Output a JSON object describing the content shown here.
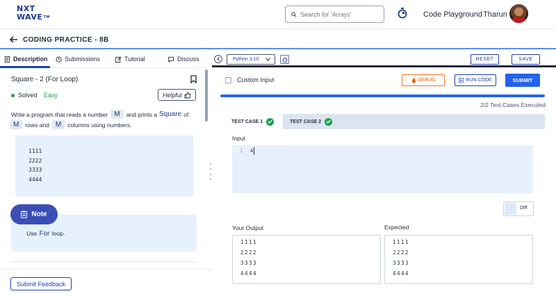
{
  "brand": {
    "logo_line1": "NXT",
    "logo_line2": "WAVE",
    "logo_tm": "TM"
  },
  "header": {
    "search_placeholder": "Search for 'Arrays'",
    "code_playground": "Code Playground",
    "username": "Tharun"
  },
  "subheader": {
    "title": "CODING PRACTICE - 8B"
  },
  "left_tabs": [
    {
      "label": "Description",
      "icon": "document-icon",
      "active": true
    },
    {
      "label": "Submissions",
      "icon": "clock-icon"
    },
    {
      "label": "Tutorial",
      "icon": "edit-icon"
    },
    {
      "label": "Discuss",
      "icon": "chat-icon"
    }
  ],
  "problem": {
    "title": "Square - 2 (For Loop)",
    "status": "Solved",
    "difficulty": "Easy",
    "helpful_label": "Helpful",
    "desc_part1": "Write a program that reads a number",
    "var_m": "M",
    "desc_part2": "and prints a",
    "square_word": "Square",
    "desc_part3": "of",
    "desc_part4": "rows and",
    "desc_part5": "columns using numbers.",
    "example_output": [
      "1111",
      "2222",
      "3333",
      "4444"
    ],
    "note_label": "Note",
    "note_use": "Use",
    "note_for": "For",
    "note_loop": "loop.",
    "feedback_label": "Submit Feedback"
  },
  "editor_toolbar": {
    "language": "Python 3.10",
    "reset_label": "RESET",
    "save_label": "SAVE"
  },
  "actions": {
    "custom_input_label": "Custom Input",
    "debug_label": "DEBUG",
    "run_label": "RUN CODE",
    "submit_label": "SUBMIT"
  },
  "results": {
    "progress_fraction": 1.0,
    "executed_text": "2/2 Test Cases Executed",
    "test_cases": [
      {
        "label": "TEST CASE 1",
        "passed": true,
        "active": true
      },
      {
        "label": "TEST CASE 2",
        "passed": true,
        "active": false
      }
    ],
    "input_label": "Input",
    "input_line_no": "1",
    "input_value": "4",
    "diff_label": "Diff",
    "your_output_label": "Your Output",
    "expected_label": "Expected",
    "your_output": [
      "1111",
      "2222",
      "3333",
      "4444"
    ],
    "expected_output": [
      "1111",
      "2222",
      "3333",
      "4444"
    ]
  },
  "colors": {
    "accent": "#2563eb",
    "brand_navy": "#1e3a8a",
    "success": "#16a34a",
    "debug_orange": "#f97316",
    "panel_bg": "#e6f1fd"
  }
}
